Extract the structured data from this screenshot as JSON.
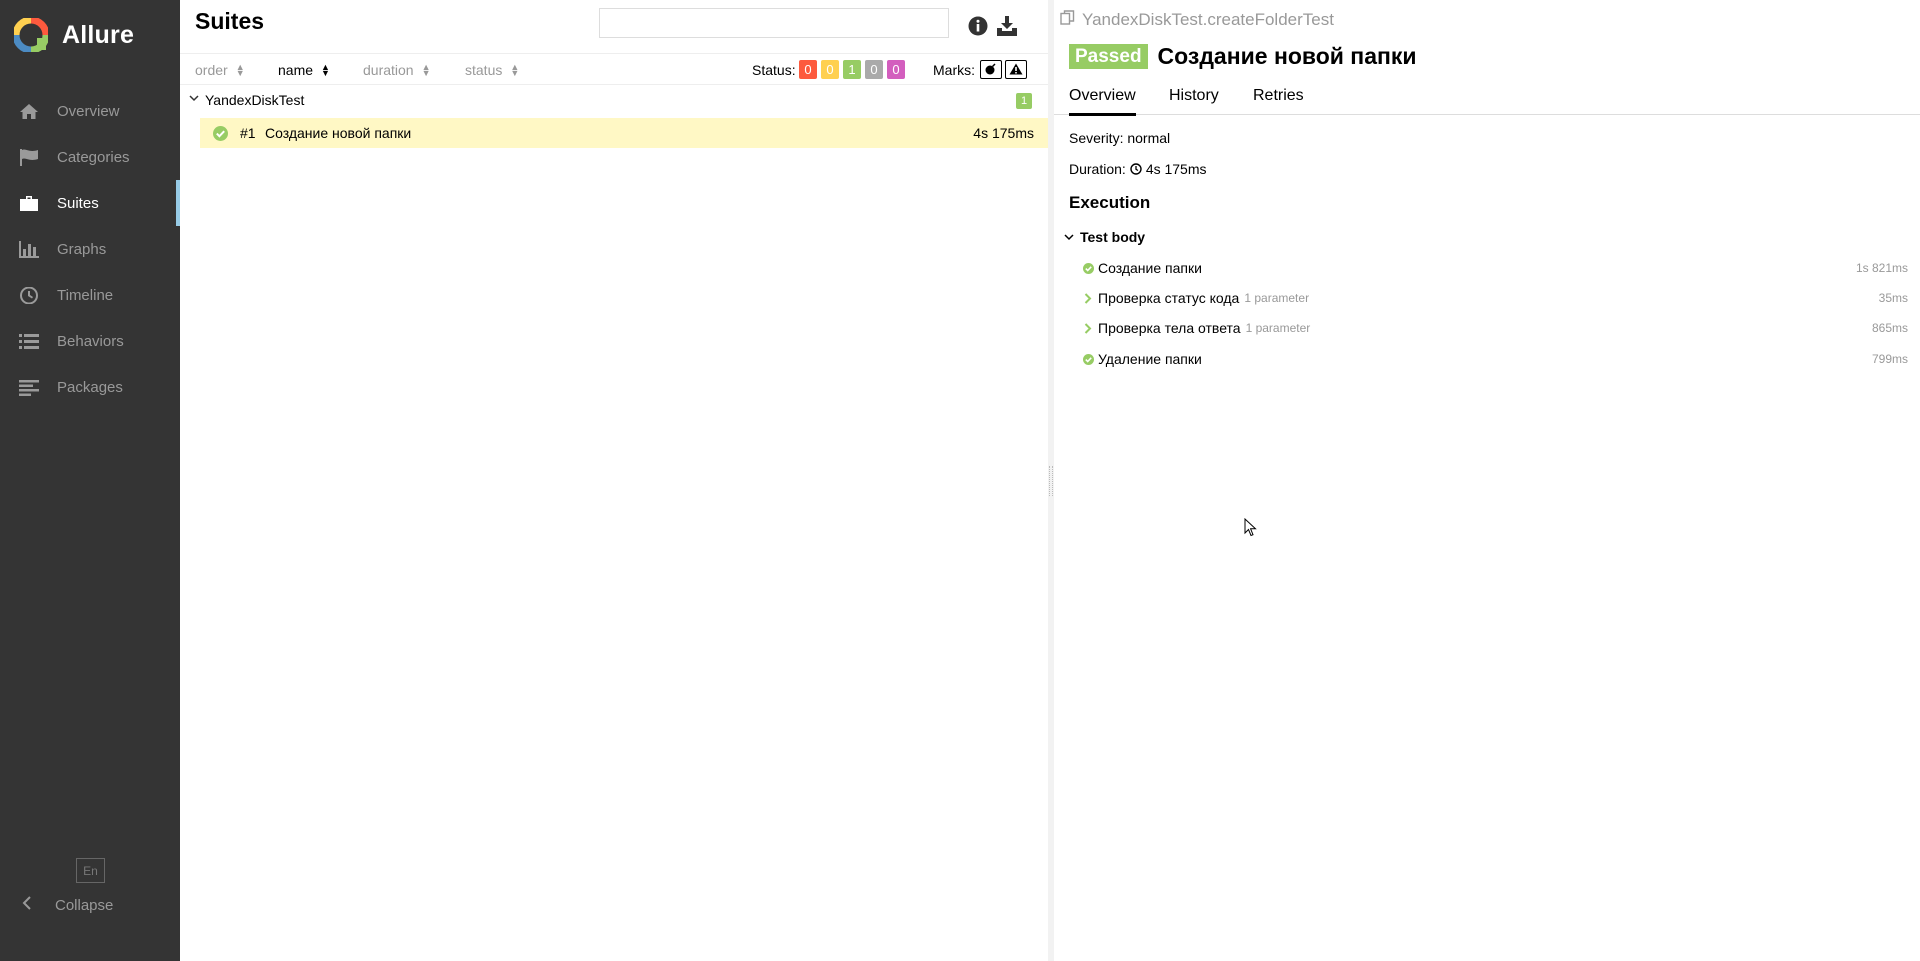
{
  "app": {
    "name": "Allure"
  },
  "sidebar": {
    "items": [
      {
        "label": "Overview",
        "icon": "home-icon"
      },
      {
        "label": "Categories",
        "icon": "flag-icon"
      },
      {
        "label": "Suites",
        "icon": "briefcase-icon",
        "active": true
      },
      {
        "label": "Graphs",
        "icon": "bar-chart-icon"
      },
      {
        "label": "Timeline",
        "icon": "clock-icon"
      },
      {
        "label": "Behaviors",
        "icon": "list-icon"
      },
      {
        "label": "Packages",
        "icon": "align-left-icon"
      }
    ],
    "language": "En",
    "collapse_label": "Collapse"
  },
  "suites": {
    "title": "Suites",
    "search": {
      "value": "",
      "placeholder": ""
    },
    "sort": {
      "order": "order",
      "name": "name",
      "duration": "duration",
      "status": "status",
      "active": "name"
    },
    "status_label": "Status:",
    "status_counts": [
      {
        "status": "failed",
        "value": "0",
        "color": "#fd5a3e"
      },
      {
        "status": "broken",
        "value": "0",
        "color": "#ffd050"
      },
      {
        "status": "passed",
        "value": "1",
        "color": "#97cc64"
      },
      {
        "status": "skipped",
        "value": "0",
        "color": "#aaaaaa"
      },
      {
        "status": "unknown",
        "value": "0",
        "color": "#d35ebe"
      }
    ],
    "marks_label": "Marks:",
    "groups": [
      {
        "name": "YandexDiskTest",
        "count": "1",
        "tests": [
          {
            "num": "#1",
            "name": "Создание новой папки",
            "duration": "4s 175ms",
            "status": "passed"
          }
        ]
      }
    ]
  },
  "detail": {
    "full_name": "YandexDiskTest.createFolderTest",
    "status_badge": "Passed",
    "title": "Создание новой папки",
    "tabs": [
      {
        "label": "Overview",
        "active": true
      },
      {
        "label": "History"
      },
      {
        "label": "Retries"
      }
    ],
    "severity": "Severity: normal",
    "duration_label": "Duration:",
    "duration": "4s 175ms",
    "execution_title": "Execution",
    "test_body_label": "Test body",
    "steps": [
      {
        "name": "Создание папки",
        "param": "",
        "duration": "1s 821ms",
        "type": "passed"
      },
      {
        "name": "Проверка статус кода",
        "param": "1 parameter",
        "duration": "35ms",
        "type": "expand"
      },
      {
        "name": "Проверка тела ответа",
        "param": "1 parameter",
        "duration": "865ms",
        "type": "expand"
      },
      {
        "name": "Удаление папки",
        "param": "",
        "duration": "799ms",
        "type": "passed"
      }
    ]
  },
  "colors": {
    "sidebar_bg": "#343434",
    "accent": "#97cbe6",
    "passed": "#97cc64",
    "selected_row": "#fff8c5"
  }
}
